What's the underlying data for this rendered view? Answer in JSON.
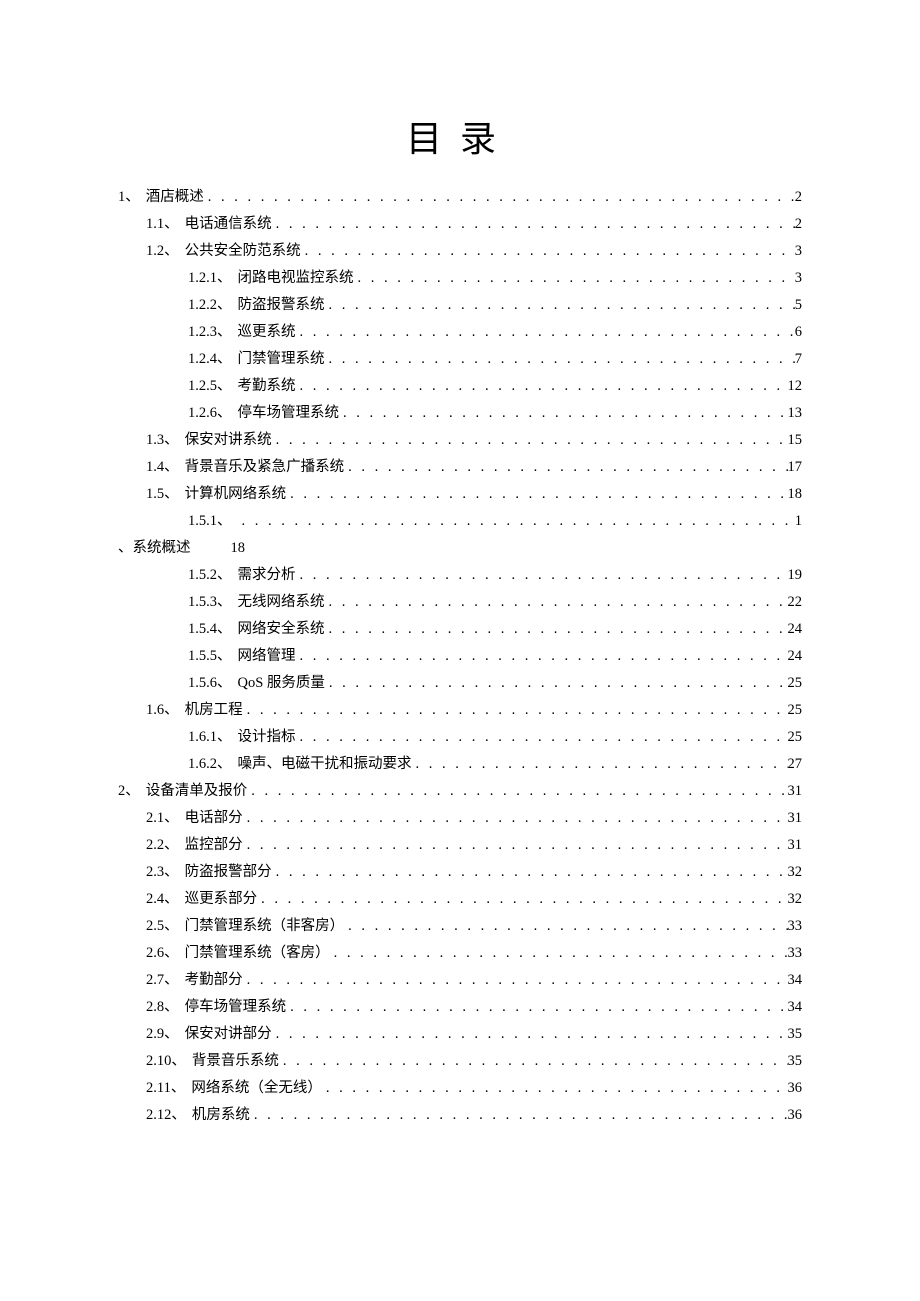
{
  "title": "目录",
  "dots": ". . . . . . . . . . . . . . . . . . . . . . . . . . . . . . . . . . . . . . . . . . . . . . . . . . . . . . . . . . . . . . . . . . . . . . . . . . . . . . . . . . . . . . . . . . . . . . . . . . . .",
  "entries": [
    {
      "lvl": 1,
      "num": "1、",
      "label": "酒店概述",
      "page": "2"
    },
    {
      "lvl": 2,
      "num": "1.1、",
      "label": "电话通信系统",
      "page": "2"
    },
    {
      "lvl": 2,
      "num": "1.2、",
      "label": "公共安全防范系统",
      "page": "3"
    },
    {
      "lvl": 3,
      "num": "1.2.1、",
      "label": "闭路电视监控系统",
      "page": "3"
    },
    {
      "lvl": 3,
      "num": "1.2.2、",
      "label": "防盗报警系统",
      "page": "5"
    },
    {
      "lvl": 3,
      "num": "1.2.3、",
      "label": "巡更系统",
      "page": "6"
    },
    {
      "lvl": 3,
      "num": "1.2.4、",
      "label": "门禁管理系统",
      "page": "7"
    },
    {
      "lvl": 3,
      "num": "1.2.5、",
      "label": "考勤系统",
      "page": "12"
    },
    {
      "lvl": 3,
      "num": "1.2.6、",
      "label": "停车场管理系统",
      "page": "13"
    },
    {
      "lvl": 2,
      "num": "1.3、",
      "label": "保安对讲系统",
      "page": "15"
    },
    {
      "lvl": 2,
      "num": "1.4、",
      "label": "背景音乐及紧急广播系统",
      "page": "17"
    },
    {
      "lvl": 2,
      "num": "1.5、",
      "label": "计算机网络系统",
      "page": "18"
    },
    {
      "lvl": 3,
      "num": "1.5.1、",
      "label": "",
      "page": "1",
      "wrap": true,
      "wrap_text_a": "、系统概述",
      "wrap_text_b": "18"
    },
    {
      "lvl": 3,
      "num": "1.5.2、",
      "label": "需求分析",
      "page": "19"
    },
    {
      "lvl": 3,
      "num": "1.5.3、",
      "label": "无线网络系统",
      "page": "22"
    },
    {
      "lvl": 3,
      "num": "1.5.4、",
      "label": "网络安全系统",
      "page": "24"
    },
    {
      "lvl": 3,
      "num": "1.5.5、",
      "label": "网络管理",
      "page": "24"
    },
    {
      "lvl": 3,
      "num": "1.5.6、",
      "label": "QoS 服务质量",
      "page": "25"
    },
    {
      "lvl": 2,
      "num": "1.6、",
      "label": "机房工程",
      "page": "25"
    },
    {
      "lvl": 3,
      "num": "1.6.1、",
      "label": "设计指标",
      "page": "25"
    },
    {
      "lvl": 3,
      "num": "1.6.2、",
      "label": "噪声、电磁干扰和振动要求",
      "page": "27"
    },
    {
      "lvl": 1,
      "num": "2、",
      "label": "设备清单及报价",
      "page": "31"
    },
    {
      "lvl": 2,
      "num": "2.1、",
      "label": "电话部分",
      "page": "31"
    },
    {
      "lvl": 2,
      "num": "2.2、",
      "label": "监控部分",
      "page": "31"
    },
    {
      "lvl": 2,
      "num": "2.3、",
      "label": "防盗报警部分",
      "page": "32"
    },
    {
      "lvl": 2,
      "num": "2.4、",
      "label": "巡更系部分",
      "page": "32"
    },
    {
      "lvl": 2,
      "num": "2.5、",
      "label": "门禁管理系统（非客房）",
      "page": "33"
    },
    {
      "lvl": 2,
      "num": "2.6、",
      "label": "门禁管理系统（客房）",
      "page": "33"
    },
    {
      "lvl": 2,
      "num": "2.7、",
      "label": "考勤部分",
      "page": "34"
    },
    {
      "lvl": 2,
      "num": "2.8、",
      "label": "停车场管理系统",
      "page": "34"
    },
    {
      "lvl": 2,
      "num": "2.9、",
      "label": "保安对讲部分",
      "page": "35"
    },
    {
      "lvl": 2,
      "num": "2.10、",
      "label": "背景音乐系统",
      "page": "35"
    },
    {
      "lvl": 2,
      "num": "2.11、",
      "label": "网络系统（全无线）",
      "page": "36"
    },
    {
      "lvl": 2,
      "num": "2.12、",
      "label": "机房系统",
      "page": "36"
    }
  ]
}
